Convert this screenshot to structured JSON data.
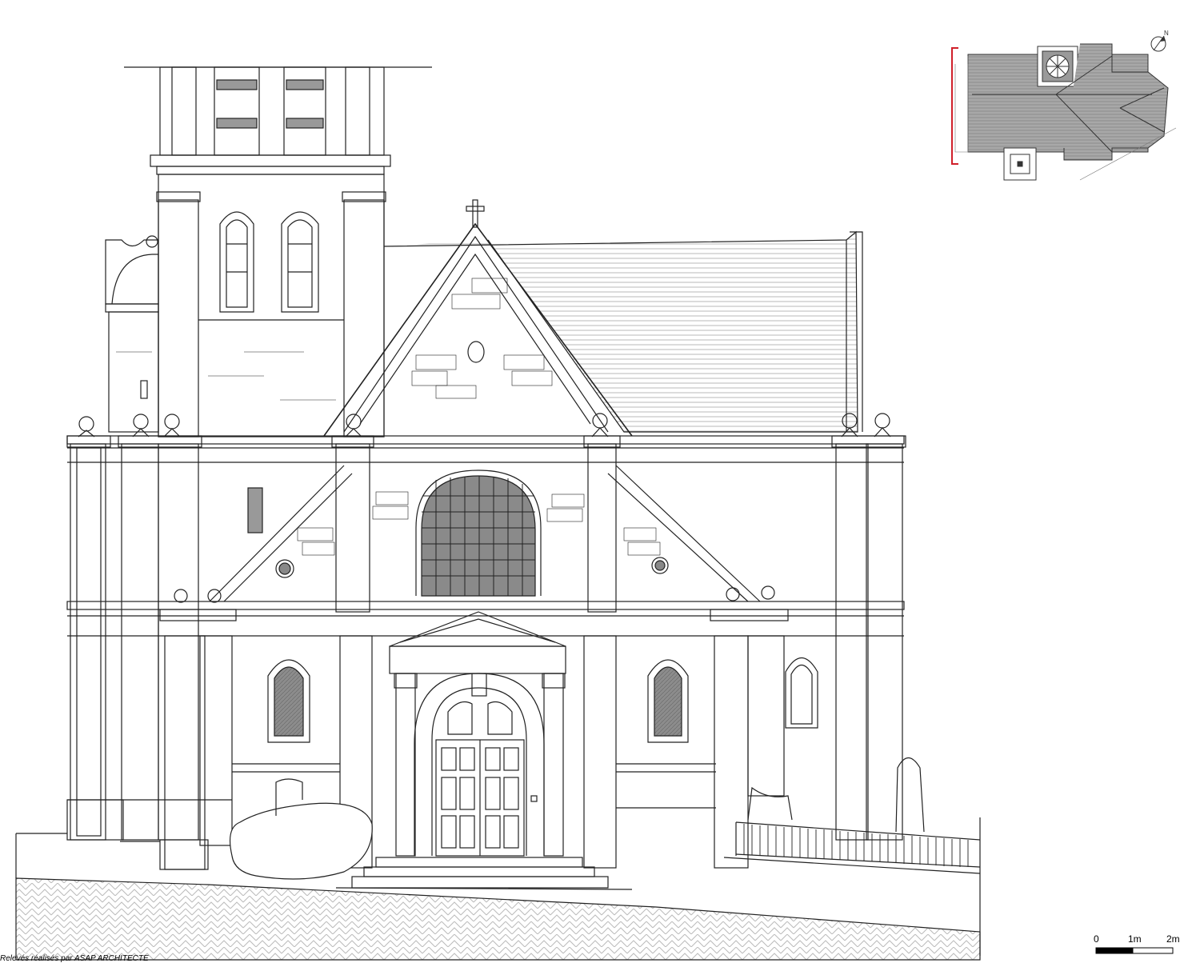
{
  "scale_bar": {
    "labels": [
      "0",
      "1m",
      "2m"
    ]
  },
  "credit": {
    "text": "Relevés réalisés par ASAP ARCHITECTE"
  },
  "north_arrow": {
    "label": "N",
    "icon": "north-arrow-icon"
  },
  "colors": {
    "line": "#222222",
    "glass": "#8a8a8a",
    "roof_plan": "#9a9a9a",
    "section_marker": "#d0202a",
    "ground_hatch": "#bdbdbd"
  }
}
